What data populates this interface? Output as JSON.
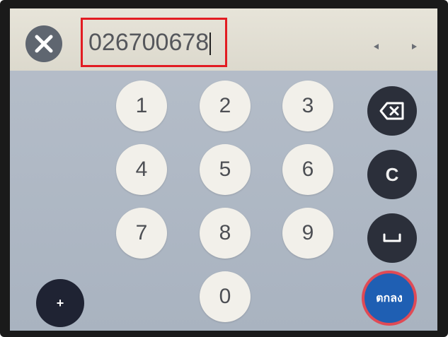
{
  "input": {
    "value": "026700678"
  },
  "keypad": {
    "digits": [
      "1",
      "2",
      "3",
      "4",
      "5",
      "6",
      "7",
      "8",
      "9",
      "0"
    ],
    "clear_label": "C",
    "plus_label": "+",
    "ok_label": "ตกลง"
  },
  "icons": {
    "close": "close-icon",
    "backspace": "backspace-icon",
    "space": "space-icon",
    "left": "arrow-left-icon",
    "right": "arrow-right-icon"
  },
  "colors": {
    "accent_ok": "#1f5fb3",
    "highlight": "#e21c22",
    "func_key": "#2b2f3a"
  }
}
